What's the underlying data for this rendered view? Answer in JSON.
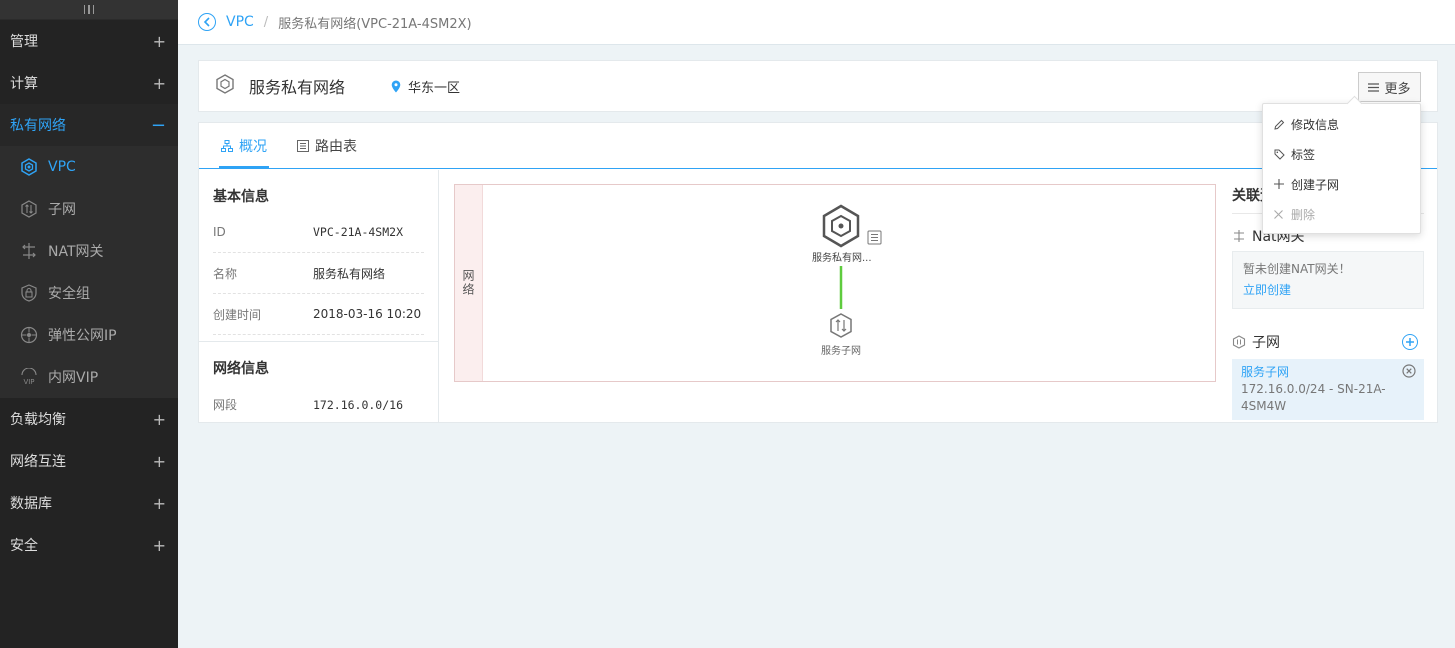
{
  "sidebar": {
    "groups_top": [
      {
        "label": "管理",
        "toggle": "+"
      },
      {
        "label": "计算",
        "toggle": "+"
      }
    ],
    "active_group": {
      "label": "私有网络",
      "toggle": "−"
    },
    "items": [
      {
        "label": "VPC"
      },
      {
        "label": "子网"
      },
      {
        "label": "NAT网关"
      },
      {
        "label": "安全组"
      },
      {
        "label": "弹性公网IP"
      },
      {
        "label": "内网VIP"
      }
    ],
    "groups_bottom": [
      {
        "label": "负载均衡",
        "toggle": "+"
      },
      {
        "label": "网络互连",
        "toggle": "+"
      },
      {
        "label": "数据库",
        "toggle": "+"
      },
      {
        "label": "安全",
        "toggle": "+"
      }
    ]
  },
  "breadcrumb": {
    "link": "VPC",
    "separator": "/",
    "current": "服务私有网络(VPC-21A-4SM2X)"
  },
  "header": {
    "title": "服务私有网络",
    "region": "华东一区",
    "more_label": "更多"
  },
  "tabs": [
    {
      "label": "概况"
    },
    {
      "label": "路由表"
    }
  ],
  "basic_info": {
    "title": "基本信息",
    "rows": [
      {
        "key": "ID",
        "value": "VPC-21A-4SM2X"
      },
      {
        "key": "名称",
        "value": "服务私有网络"
      },
      {
        "key": "创建时间",
        "value": "2018-03-16 10:20"
      }
    ]
  },
  "network_info": {
    "title": "网络信息",
    "rows": [
      {
        "key": "网段",
        "value": "172.16.0.0/16"
      }
    ]
  },
  "topology": {
    "band_label": "网络",
    "vpc_node": "服务私有网...",
    "subnet_node": "服务子网"
  },
  "associations": {
    "title": "关联资",
    "nat": {
      "title": "Nat网关",
      "empty_text": "暂未创建NAT网关！",
      "create_link": "立即创建"
    },
    "subnet": {
      "title": "子网",
      "name": "服务子网",
      "detail": "172.16.0.0/24 - SN-21A-4SM4W"
    }
  },
  "dropdown": {
    "items": [
      {
        "label": "修改信息"
      },
      {
        "label": "标签"
      },
      {
        "label": "创建子网"
      },
      {
        "label": "删除"
      }
    ]
  },
  "colors": {
    "accent": "#2fa3f5",
    "sidebar_bg": "#232323",
    "link_line": "#5fcc3e"
  }
}
